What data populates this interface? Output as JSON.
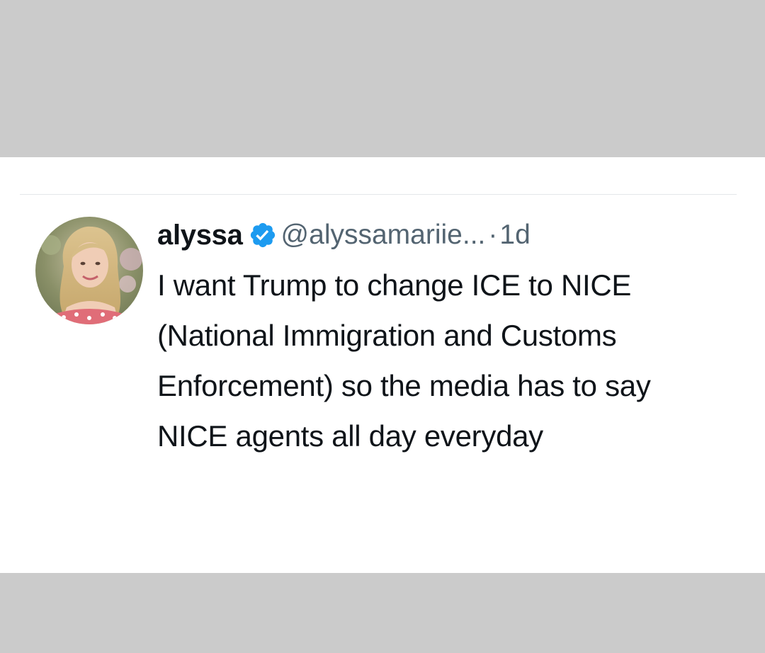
{
  "tweet": {
    "display_name": "alyssa",
    "verified": true,
    "verified_icon": "verified-badge-icon",
    "verified_color": "#1d9bf0",
    "handle": "@alyssamariie...",
    "separator": "·",
    "time": "1d",
    "text": "I want Trump to change ICE to NICE (National Immigration and Customs Enforcement) so the media has to say NICE agents all day everyday"
  }
}
